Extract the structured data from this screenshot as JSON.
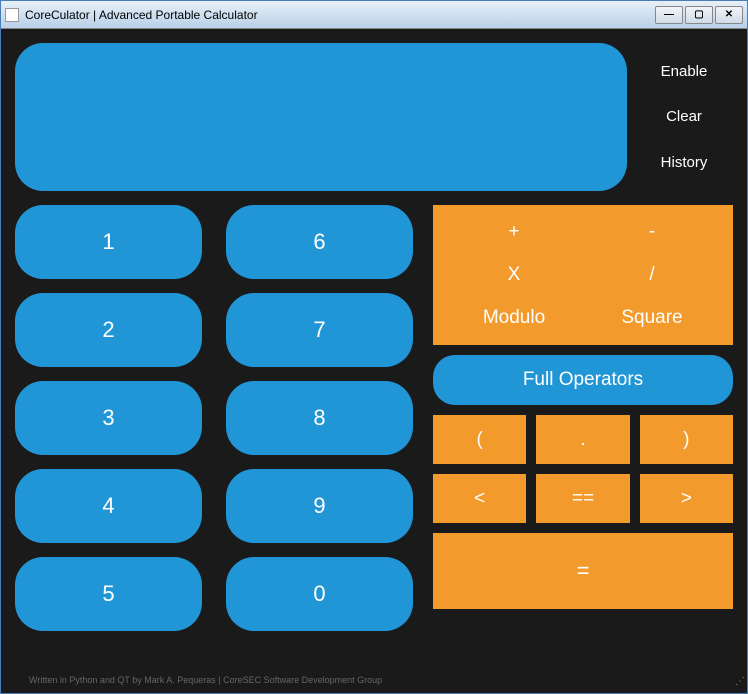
{
  "window": {
    "title": "CoreCulator | Advanced Portable Calculator"
  },
  "display_buttons": {
    "enable": "Enable",
    "clear": "Clear",
    "history": "History"
  },
  "numpad": {
    "n1": "1",
    "n6": "6",
    "n2": "2",
    "n7": "7",
    "n3": "3",
    "n8": "8",
    "n4": "4",
    "n9": "9",
    "n5": "5",
    "n0": "0"
  },
  "operators": {
    "plus": "+",
    "minus": "-",
    "multiply": "X",
    "divide": "/",
    "modulo": "Modulo",
    "square": "Square"
  },
  "full_operators": "Full Operators",
  "symbols": {
    "lparen": "(",
    "dot": ".",
    "rparen": ")",
    "lt": "<",
    "eq": "==",
    "gt": ">"
  },
  "equals": "=",
  "footer": "Written in Python and QT by Mark A. Pequeras | CoreSEC Software Development Group"
}
